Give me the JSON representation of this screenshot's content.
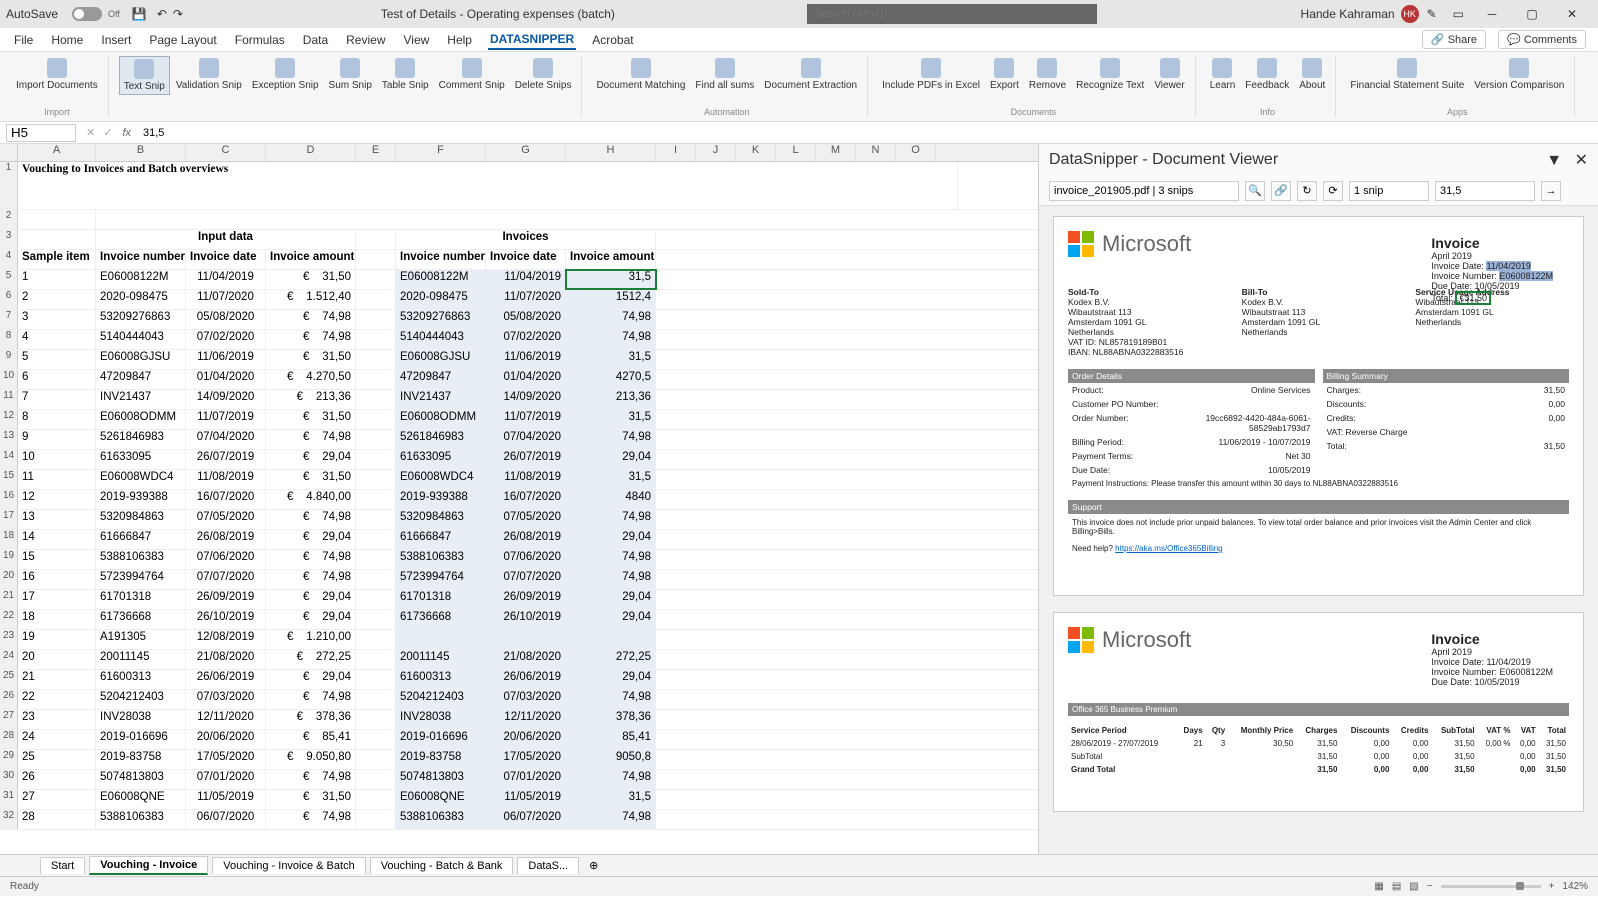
{
  "titlebar": {
    "autosave": "AutoSave",
    "autosave_state": "Off",
    "doc_title": "Test of Details - Operating expenses (batch)",
    "search_placeholder": "Search (Alt+Q)",
    "user_name": "Hande Kahraman",
    "user_initials": "HK"
  },
  "menu": {
    "tabs": [
      "File",
      "Home",
      "Insert",
      "Page Layout",
      "Formulas",
      "Data",
      "Review",
      "View",
      "Help",
      "DATASNIPPER",
      "Acrobat"
    ],
    "active": 9,
    "share": "Share",
    "comments": "Comments"
  },
  "ribbon": {
    "groups": [
      {
        "label": "Import",
        "items": [
          "Import Documents"
        ]
      },
      {
        "label": "",
        "items": [
          "Text Snip",
          "Validation Snip",
          "Exception Snip",
          "Sum Snip",
          "Table Snip",
          "Comment Snip",
          "Delete Snips"
        ],
        "active": 0
      },
      {
        "label": "Automation",
        "items": [
          "Document Matching",
          "Find all sums",
          "Document Extraction"
        ]
      },
      {
        "label": "Documents",
        "items": [
          "Include PDFs in Excel",
          "Export",
          "Remove",
          "Recognize Text",
          "Viewer"
        ]
      },
      {
        "label": "Info",
        "items": [
          "Learn",
          "Feedback",
          "About"
        ]
      },
      {
        "label": "Apps",
        "items": [
          "Financial Statement Suite",
          "Version Comparison"
        ]
      }
    ]
  },
  "formula": {
    "cell": "H5",
    "value": "31,5"
  },
  "columns": [
    "A",
    "B",
    "C",
    "D",
    "E",
    "F",
    "G",
    "H",
    "I",
    "J",
    "K",
    "L",
    "M",
    "N",
    "O"
  ],
  "sheet": {
    "title": "Vouching to Invoices and Batch overviews",
    "input_header": "Input data",
    "invoices_header": "Invoices",
    "headers_left": [
      "Sample item",
      "Invoice number",
      "Invoice date",
      "Invoice amount"
    ],
    "headers_right": [
      "Invoice number",
      "Invoice date",
      "Invoice amount"
    ],
    "rows": [
      {
        "n": 1,
        "in": "E06008122M",
        "id": "11/04/2019",
        "ia": "31,50",
        "rin": "E06008122M",
        "rid": "11/04/2019",
        "ria": "31,5",
        "sel": true
      },
      {
        "n": 2,
        "in": "2020-098475",
        "id": "11/07/2020",
        "ia": "1.512,40",
        "rin": "2020-098475",
        "rid": "11/07/2020",
        "ria": "1512,4"
      },
      {
        "n": 3,
        "in": "53209276863",
        "id": "05/08/2020",
        "ia": "74,98",
        "rin": "53209276863",
        "rid": "05/08/2020",
        "ria": "74,98"
      },
      {
        "n": 4,
        "in": "5140444043",
        "id": "07/02/2020",
        "ia": "74,98",
        "rin": "5140444043",
        "rid": "07/02/2020",
        "ria": "74,98"
      },
      {
        "n": 5,
        "in": "E06008GJSU",
        "id": "11/06/2019",
        "ia": "31,50",
        "rin": "E06008GJSU",
        "rid": "11/06/2019",
        "ria": "31,5"
      },
      {
        "n": 6,
        "in": "47209847",
        "id": "01/04/2020",
        "ia": "4.270,50",
        "rin": "47209847",
        "rid": "01/04/2020",
        "ria": "4270,5"
      },
      {
        "n": 7,
        "in": "INV21437",
        "id": "14/09/2020",
        "ia": "213,36",
        "rin": "INV21437",
        "rid": "14/09/2020",
        "ria": "213,36"
      },
      {
        "n": 8,
        "in": "E06008ODMM",
        "id": "11/07/2019",
        "ia": "31,50",
        "rin": "E06008ODMM",
        "rid": "11/07/2019",
        "ria": "31,5"
      },
      {
        "n": 9,
        "in": "5261846983",
        "id": "07/04/2020",
        "ia": "74,98",
        "rin": "5261846983",
        "rid": "07/04/2020",
        "ria": "74,98"
      },
      {
        "n": 10,
        "in": "61633095",
        "id": "26/07/2019",
        "ia": "29,04",
        "rin": "61633095",
        "rid": "26/07/2019",
        "ria": "29,04"
      },
      {
        "n": 11,
        "in": "E06008WDC4",
        "id": "11/08/2019",
        "ia": "31,50",
        "rin": "E06008WDC4",
        "rid": "11/08/2019",
        "ria": "31,5"
      },
      {
        "n": 12,
        "in": "2019-939388",
        "id": "16/07/2020",
        "ia": "4.840,00",
        "rin": "2019-939388",
        "rid": "16/07/2020",
        "ria": "4840"
      },
      {
        "n": 13,
        "in": "5320984863",
        "id": "07/05/2020",
        "ia": "74,98",
        "rin": "5320984863",
        "rid": "07/05/2020",
        "ria": "74,98"
      },
      {
        "n": 14,
        "in": "61666847",
        "id": "26/08/2019",
        "ia": "29,04",
        "rin": "61666847",
        "rid": "26/08/2019",
        "ria": "29,04"
      },
      {
        "n": 15,
        "in": "5388106383",
        "id": "07/06/2020",
        "ia": "74,98",
        "rin": "5388106383",
        "rid": "07/06/2020",
        "ria": "74,98"
      },
      {
        "n": 16,
        "in": "5723994764",
        "id": "07/07/2020",
        "ia": "74,98",
        "rin": "5723994764",
        "rid": "07/07/2020",
        "ria": "74,98"
      },
      {
        "n": 17,
        "in": "61701318",
        "id": "26/09/2019",
        "ia": "29,04",
        "rin": "61701318",
        "rid": "26/09/2019",
        "ria": "29,04"
      },
      {
        "n": 18,
        "in": "61736668",
        "id": "26/10/2019",
        "ia": "29,04",
        "rin": "61736668",
        "rid": "26/10/2019",
        "ria": "29,04"
      },
      {
        "n": 19,
        "in": "A191305",
        "id": "12/08/2019",
        "ia": "1.210,00",
        "rin": "",
        "rid": "",
        "ria": ""
      },
      {
        "n": 20,
        "in": "20011145",
        "id": "21/08/2020",
        "ia": "272,25",
        "rin": "20011145",
        "rid": "21/08/2020",
        "ria": "272,25"
      },
      {
        "n": 21,
        "in": "61600313",
        "id": "26/06/2019",
        "ia": "29,04",
        "rin": "61600313",
        "rid": "26/06/2019",
        "ria": "29,04"
      },
      {
        "n": 22,
        "in": "5204212403",
        "id": "07/03/2020",
        "ia": "74,98",
        "rin": "5204212403",
        "rid": "07/03/2020",
        "ria": "74,98"
      },
      {
        "n": 23,
        "in": "INV28038",
        "id": "12/11/2020",
        "ia": "378,36",
        "rin": "INV28038",
        "rid": "12/11/2020",
        "ria": "378,36"
      },
      {
        "n": 24,
        "in": "2019-016696",
        "id": "20/06/2020",
        "ia": "85,41",
        "rin": "2019-016696",
        "rid": "20/06/2020",
        "ria": "85,41"
      },
      {
        "n": 25,
        "in": "2019-83758",
        "id": "17/05/2020",
        "ia": "9.050,80",
        "rin": "2019-83758",
        "rid": "17/05/2020",
        "ria": "9050,8"
      },
      {
        "n": 26,
        "in": "5074813803",
        "id": "07/01/2020",
        "ia": "74,98",
        "rin": "5074813803",
        "rid": "07/01/2020",
        "ria": "74,98"
      },
      {
        "n": 27,
        "in": "E06008QNE",
        "id": "11/05/2019",
        "ia": "31,50",
        "rin": "E06008QNE",
        "rid": "11/05/2019",
        "ria": "31,5"
      },
      {
        "n": 28,
        "in": "5388106383",
        "id": "06/07/2020",
        "ia": "74,98",
        "rin": "5388106383",
        "rid": "06/07/2020",
        "ria": "74,98"
      }
    ]
  },
  "sheettabs": {
    "tabs": [
      "Start",
      "Vouching - Invoice",
      "Vouching - Invoice & Batch",
      "Vouching - Batch & Bank",
      "DataS..."
    ],
    "active": 1
  },
  "dv": {
    "title": "DataSnipper - Document Viewer",
    "doc": "invoice_201905.pdf | 3 snips",
    "snip": "1 snip",
    "val": "31,5",
    "page1": {
      "logo": "Microsoft",
      "inv": {
        "title": "Invoice",
        "period": "April 2019",
        "date_label": "Invoice Date:",
        "date": "11/04/2019",
        "num_label": "Invoice Number:",
        "num": "E06008122M",
        "due_label": "Due Date:",
        "due": "10/05/2019",
        "total_label": "Total:",
        "total": "€31,50"
      },
      "soldto": {
        "h": "Sold-To",
        "name": "Kodex B.V.",
        "addr1": "Wibautstraat 113",
        "addr2": "Amsterdam 1091 GL",
        "addr3": "Netherlands",
        "vat": "VAT ID: NL857819189B01",
        "iban": "IBAN: NL88ABNA0322883516"
      },
      "billto": {
        "h": "Bill-To",
        "name": "Kodex B.V.",
        "addr1": "Wibautstraat 113",
        "addr2": "Amsterdam 1091 GL",
        "addr3": "Netherlands"
      },
      "usage": {
        "h": "Service Usage Address",
        "addr1": "Wibautstraat 113",
        "addr2": "Amsterdam 1091 GL",
        "addr3": "Netherlands"
      },
      "order": {
        "h": "Order Details",
        "product_l": "Product:",
        "product": "Online Services",
        "po_l": "Customer PO Number:",
        "ord_l": "Order Number:",
        "ord": "19cc6892-4420-484a-6061-58529ab1793d7",
        "bp_l": "Billing Period:",
        "bp": "11/06/2019 - 10/07/2019",
        "pt_l": "Payment Terms:",
        "pt": "Net 30",
        "dd_l": "Due Date:",
        "dd": "10/05/2019",
        "pi_l": "Payment Instructions:",
        "pi": "Please transfer this amount within 30 days to NL88ABNA0322883516"
      },
      "billing": {
        "h": "Billing Summary",
        "charges_l": "Charges:",
        "charges": "31,50",
        "disc_l": "Discounts:",
        "disc": "0,00",
        "cred_l": "Credits:",
        "cred": "0,00",
        "vat_l": "VAT: Reverse Charge",
        "vat": "",
        "total_l": "Total:",
        "total": "31,50"
      },
      "support": {
        "h": "Support",
        "txt": "This invoice does not include prior unpaid balances. To view total order balance and prior invoices visit the Admin Center and click Billing>Bills.",
        "help": "Need help?",
        "link": "https://aka.ms/Office365Billing"
      }
    },
    "page2": {
      "logo": "Microsoft",
      "inv": {
        "title": "Invoice",
        "period": "April 2019",
        "date": "Invoice Date: 11/04/2019",
        "num": "Invoice Number: E06008122M",
        "due": "Due Date: 10/05/2019"
      },
      "section": "Office 365 Business Premium",
      "cols": [
        "Service Period",
        "Days",
        "Qty",
        "Monthly Price",
        "Charges",
        "Discounts",
        "Credits",
        "SubTotal",
        "VAT %",
        "VAT",
        "Total"
      ],
      "row": [
        "28/06/2019 - 27/07/2019",
        "21",
        "3",
        "30,50",
        "31,50",
        "0,00",
        "0,00",
        "31,50",
        "0,00 %",
        "0,00",
        "31,50"
      ],
      "sub": [
        "SubTotal",
        "",
        "",
        "",
        "31,50",
        "0,00",
        "0,00",
        "31,50",
        "",
        "0,00",
        "31,50"
      ],
      "gt": [
        "Grand Total",
        "",
        "",
        "",
        "31,50",
        "0,00",
        "0,00",
        "31,50",
        "",
        "0,00",
        "31,50"
      ]
    }
  },
  "status": {
    "ready": "Ready",
    "zoom": "142%"
  }
}
